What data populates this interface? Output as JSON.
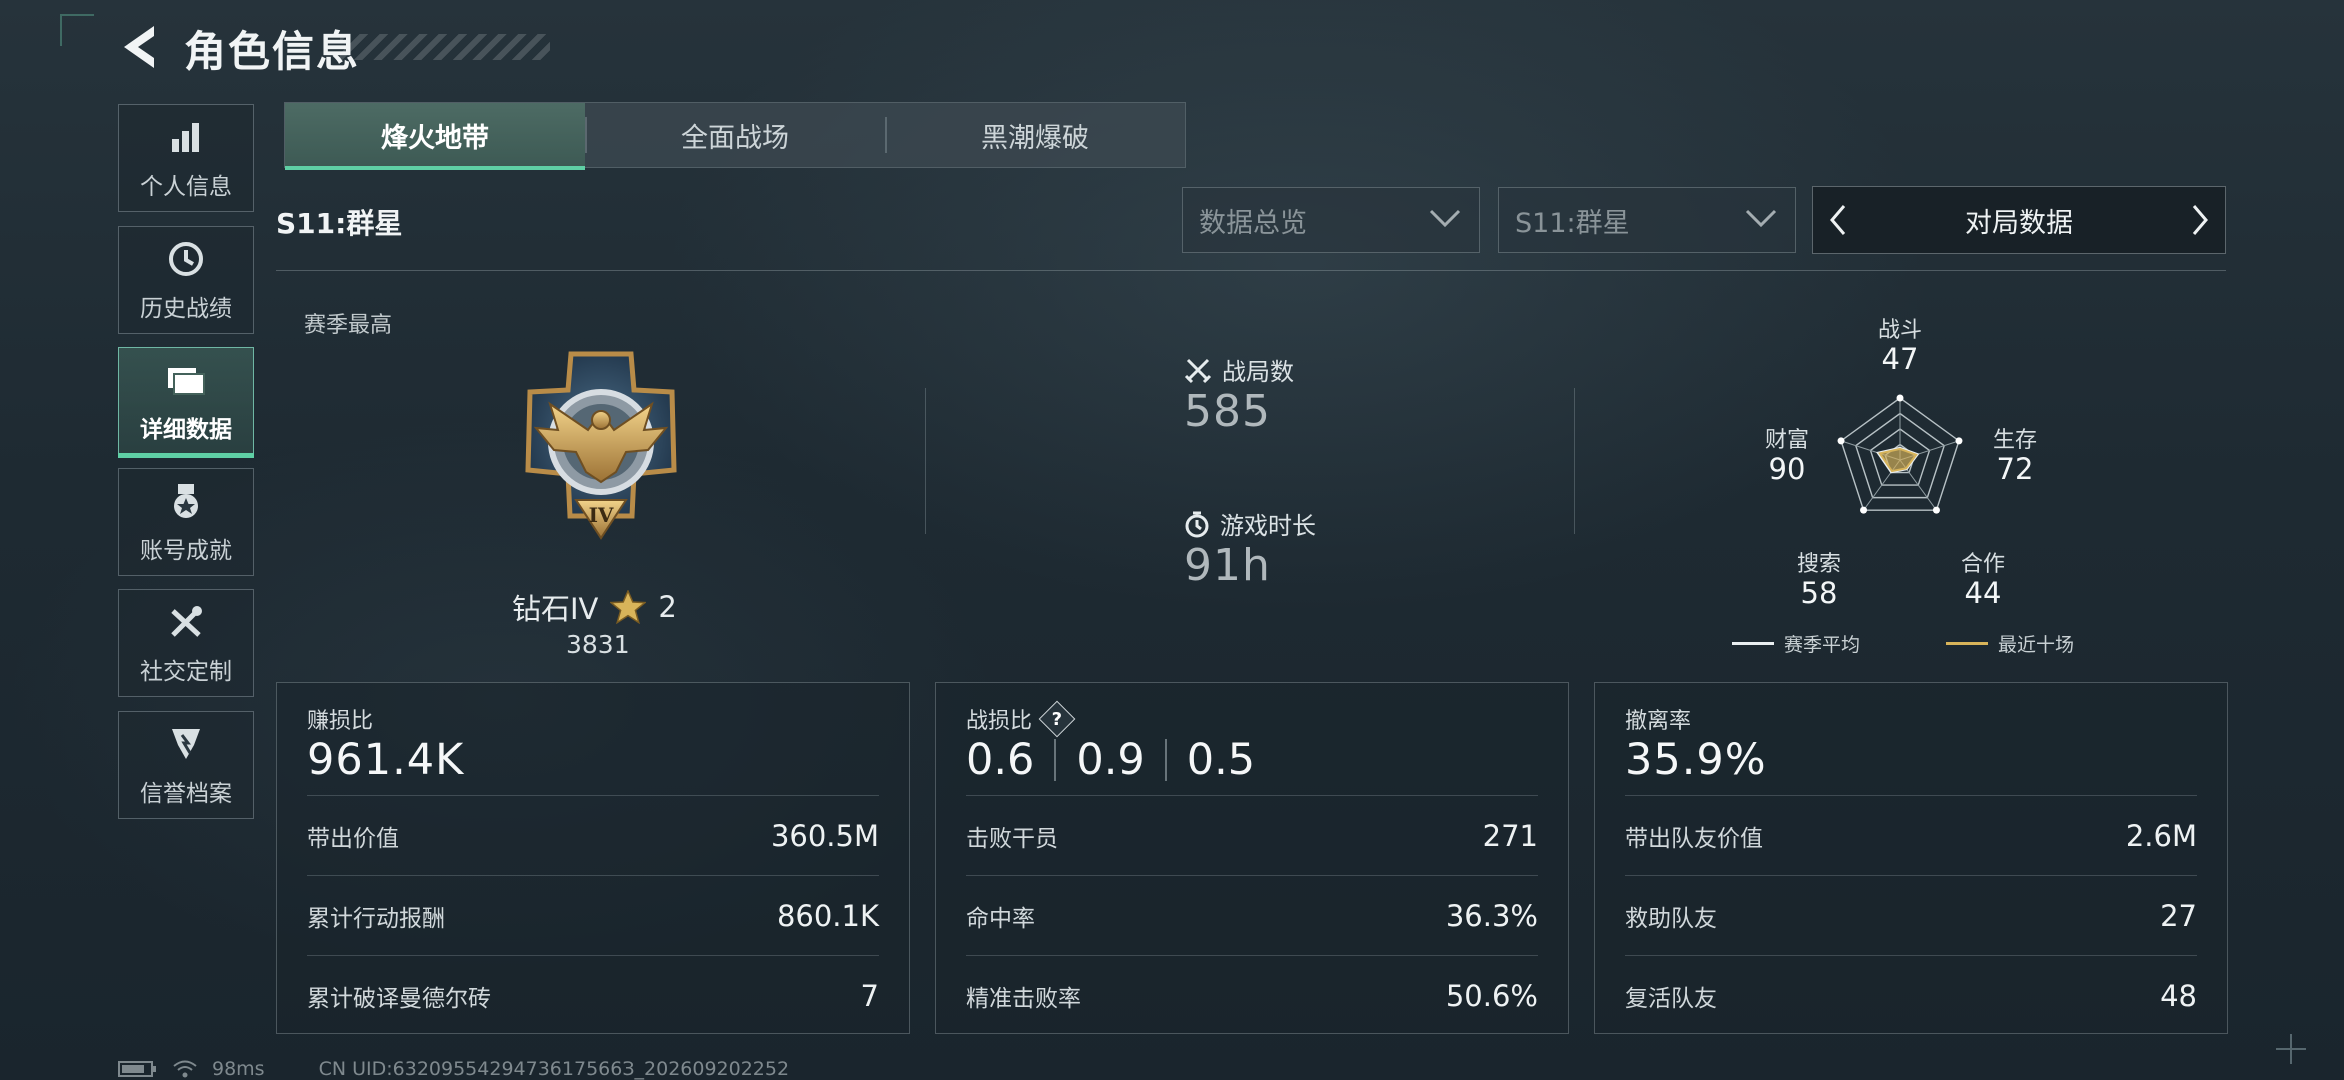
{
  "header": {
    "title": "角色信息"
  },
  "sidebar": {
    "items": [
      {
        "label": "个人信息",
        "icon": "bar-chart-icon"
      },
      {
        "label": "历史战绩",
        "icon": "clock-icon"
      },
      {
        "label": "详细数据",
        "icon": "folder-icon",
        "active": true
      },
      {
        "label": "账号成就",
        "icon": "medal-icon"
      },
      {
        "label": "社交定制",
        "icon": "tools-icon"
      },
      {
        "label": "信誉档案",
        "icon": "shield-badge-icon"
      }
    ]
  },
  "tabs": [
    {
      "label": "烽火地带",
      "active": true
    },
    {
      "label": "全面战场"
    },
    {
      "label": "黑潮爆破"
    }
  ],
  "season": {
    "title": "S11:群星"
  },
  "filters": {
    "scope_value": "数据总览",
    "season_value": "S11:群星",
    "stats_nav_label": "对局数据"
  },
  "overview": {
    "season_best_label": "赛季最高",
    "rank_name": "钻石IV",
    "rank_stars": "2",
    "rank_score": "3831",
    "matches_label": "战局数",
    "matches_value": "585",
    "playtime_label": "游戏时长",
    "playtime_value": "91h"
  },
  "radar": {
    "axes": [
      {
        "label": "战斗",
        "value": "47"
      },
      {
        "label": "生存",
        "value": "72"
      },
      {
        "label": "合作",
        "value": "44"
      },
      {
        "label": "搜索",
        "value": "58"
      },
      {
        "label": "财富",
        "value": "90"
      }
    ],
    "legend": [
      {
        "label": "赛季平均",
        "color": "#e9eef0"
      },
      {
        "label": "最近十场",
        "color": "#d8b45a"
      }
    ]
  },
  "cards": [
    {
      "title": "赚损比",
      "main": "961.4K",
      "rows": [
        {
          "label": "带出价值",
          "value": "360.5M"
        },
        {
          "label": "累计行动报酬",
          "value": "860.1K"
        },
        {
          "label": "累计破译曼德尔砖",
          "value": "7"
        }
      ]
    },
    {
      "title": "战损比",
      "triple": [
        "0.6",
        "0.9",
        "0.5"
      ],
      "rows": [
        {
          "label": "击败干员",
          "value": "271"
        },
        {
          "label": "命中率",
          "value": "36.3%"
        },
        {
          "label": "精准击败率",
          "value": "50.6%"
        }
      ]
    },
    {
      "title": "撤离率",
      "main": "35.9%",
      "rows": [
        {
          "label": "带出队友价值",
          "value": "2.6M"
        },
        {
          "label": "救助队友",
          "value": "27"
        },
        {
          "label": "复活队友",
          "value": "48"
        }
      ]
    }
  ],
  "footer": {
    "ping": "98ms",
    "uid": "CN UID:6320955429473617566З_202609202252"
  },
  "colors": {
    "accent": "#5fd0a5",
    "gold": "#d8b45a"
  }
}
